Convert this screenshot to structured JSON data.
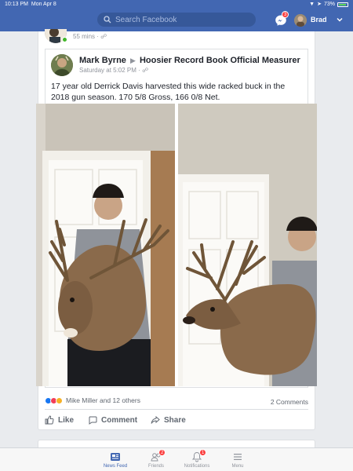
{
  "status": {
    "time": "10:13 PM",
    "date": "Mon Apr 8",
    "battery": "73%"
  },
  "nav": {
    "search_placeholder": "Search Facebook",
    "messenger_badge": "3",
    "user_name": "Brad"
  },
  "previous_post": {
    "time": "55 mins ·"
  },
  "shared_post": {
    "author": "Mark Byrne",
    "target": "Hoosier Record Book Official Measurer",
    "time": "Saturday at 5:02 PM ·",
    "text": "17 year old Derrick Davis harvested this wide racked buck in the 2018 gun season. 170 5/8 Gross, 166 0/8 Net."
  },
  "engagement": {
    "reactions_text": "Mike Miller and 12 others",
    "comments": "2 Comments"
  },
  "actions": {
    "like": "Like",
    "comment": "Comment",
    "share": "Share"
  },
  "tabs": [
    {
      "label": "News Feed",
      "icon": "news-feed-icon",
      "badge": ""
    },
    {
      "label": "Friends",
      "icon": "friends-icon",
      "badge": "2"
    },
    {
      "label": "Notifications",
      "icon": "bell-icon",
      "badge": "1"
    },
    {
      "label": "Menu",
      "icon": "menu-icon",
      "badge": ""
    }
  ],
  "colors": {
    "brand": "#4267b2",
    "badge": "#fa3e3e",
    "like_blue": "#1877f2",
    "love_red": "#f33e58"
  }
}
